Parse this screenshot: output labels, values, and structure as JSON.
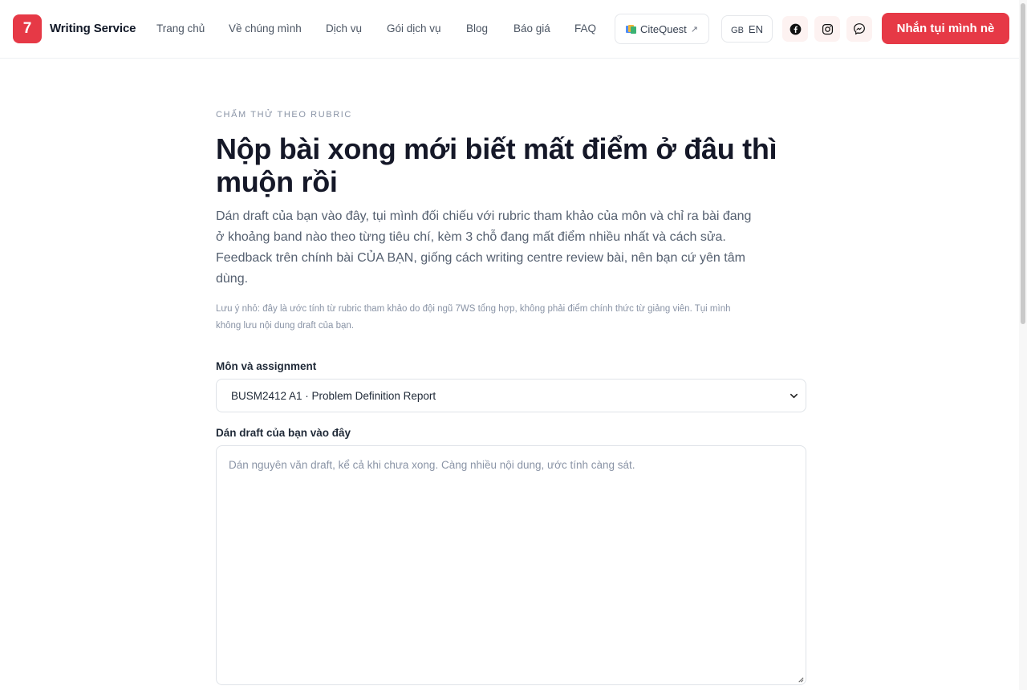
{
  "header": {
    "logo_number": "7",
    "brand": "Writing Service",
    "nav": [
      {
        "label": "Trang chủ"
      },
      {
        "label": "Về chúng mình"
      },
      {
        "label": "Dịch vụ"
      },
      {
        "label": "Gói dịch vụ"
      },
      {
        "label": "Blog"
      },
      {
        "label": "Báo giá"
      },
      {
        "label": "FAQ"
      }
    ],
    "citequest_label": "CiteQuest",
    "citequest_arrow": "↗",
    "lang_flag": "GB",
    "lang_code": "EN",
    "cta_label": "Nhắn tụi mình nè",
    "social_icons": [
      "facebook-icon",
      "instagram-icon",
      "messenger-icon"
    ]
  },
  "main": {
    "eyebrow": "CHẤM THỬ THEO RUBRIC",
    "title": "Nộp bài xong mới biết mất điểm ở đâu thì muộn rồi",
    "lead": "Dán draft của bạn vào đây, tụi mình đối chiếu với rubric tham khảo của môn và chỉ ra bài đang ở khoảng band nào theo từng tiêu chí, kèm 3 chỗ đang mất điểm nhiều nhất và cách sửa. Feedback trên chính bài CỦA BẠN, giống cách writing centre review bài, nên bạn cứ yên tâm dùng.",
    "note": "Lưu ý nhỏ: đây là ước tính từ rubric tham khảo do đội ngũ 7WS tổng hợp, không phải điểm chính thức từ giảng viên. Tụi mình không lưu nội dung draft của bạn.",
    "assignment_label": "Môn và assignment",
    "assignment_selected": "BUSM2412 A1 · Problem Definition Report",
    "draft_label": "Dán draft của bạn vào đây",
    "draft_placeholder": "Dán nguyên văn draft, kể cả khi chưa xong. Càng nhiều nội dung, ước tính càng sát."
  },
  "colors": {
    "accent": "#e63946",
    "text_dark": "#151828",
    "text_muted": "#556070"
  }
}
